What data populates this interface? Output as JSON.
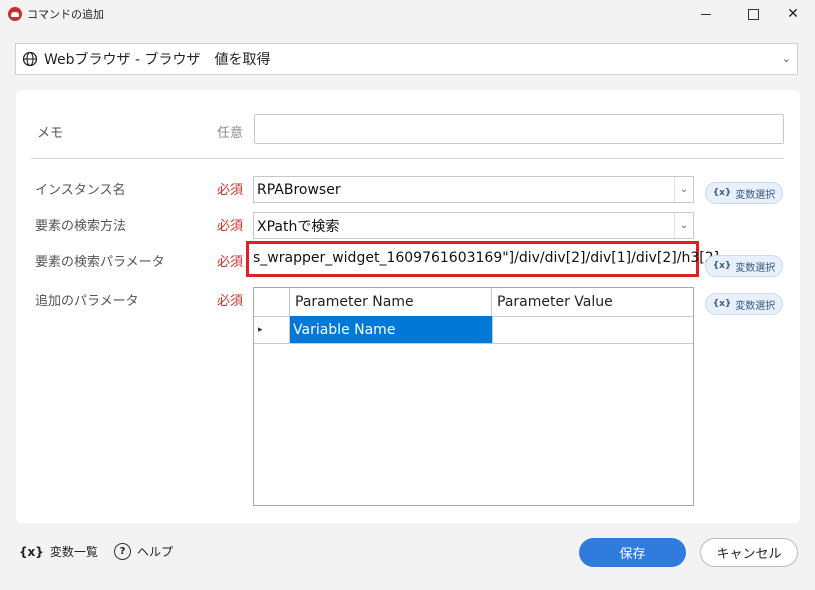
{
  "window": {
    "title": "コマンドの追加",
    "minimize_icon": "minimize-icon",
    "maximize_icon": "maximize-icon",
    "close_glyph": "✕"
  },
  "header": {
    "icon": "globe-icon",
    "command": "Webブラウザ - ブラウザ　値を取得",
    "chevron": "⌄"
  },
  "form": {
    "memo": {
      "label": "メモ",
      "requirement": "任意",
      "value": ""
    },
    "instance": {
      "label": "インスタンス名",
      "requirement": "必須",
      "value": "RPABrowser"
    },
    "search_method": {
      "label": "要素の検索方法",
      "requirement": "必須",
      "value": "XPathで検索"
    },
    "search_param": {
      "label": "要素の検索パラメータ",
      "requirement": "必須",
      "value": "s_wrapper_widget_1609761603169\"]/div/div[2]/div[1]/div[2]/h3[2]"
    },
    "extra_params": {
      "label": "追加のパラメータ",
      "requirement": "必須"
    },
    "dropdown_glyph": "⌄"
  },
  "var_button": {
    "prefix": "{x}",
    "label": "変数選択"
  },
  "grid": {
    "columns": [
      "Parameter Name",
      "Parameter Value"
    ],
    "rows": [
      {
        "indicator": "▸",
        "name": "Variable Name",
        "value": ""
      }
    ]
  },
  "footer": {
    "var_list_prefix": "{x}",
    "var_list_label": "変数一覧",
    "help_glyph": "?",
    "help_label": "ヘルプ",
    "save": "保存",
    "cancel": "キャンセル"
  },
  "colors": {
    "required": "#d0312d",
    "accent": "#2f7cdc",
    "highlight": "#e02020",
    "selected_cell": "#0078d7"
  }
}
